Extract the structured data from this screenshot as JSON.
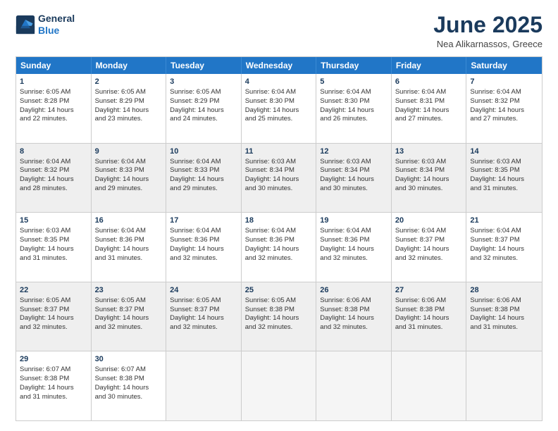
{
  "header": {
    "logo_line1": "General",
    "logo_line2": "Blue",
    "month": "June 2025",
    "location": "Nea Alikarnassos, Greece"
  },
  "weekdays": [
    "Sunday",
    "Monday",
    "Tuesday",
    "Wednesday",
    "Thursday",
    "Friday",
    "Saturday"
  ],
  "rows": [
    [
      {
        "day": "1",
        "lines": [
          "Sunrise: 6:05 AM",
          "Sunset: 8:28 PM",
          "Daylight: 14 hours",
          "and 22 minutes."
        ],
        "shade": false
      },
      {
        "day": "2",
        "lines": [
          "Sunrise: 6:05 AM",
          "Sunset: 8:29 PM",
          "Daylight: 14 hours",
          "and 23 minutes."
        ],
        "shade": false
      },
      {
        "day": "3",
        "lines": [
          "Sunrise: 6:05 AM",
          "Sunset: 8:29 PM",
          "Daylight: 14 hours",
          "and 24 minutes."
        ],
        "shade": false
      },
      {
        "day": "4",
        "lines": [
          "Sunrise: 6:04 AM",
          "Sunset: 8:30 PM",
          "Daylight: 14 hours",
          "and 25 minutes."
        ],
        "shade": false
      },
      {
        "day": "5",
        "lines": [
          "Sunrise: 6:04 AM",
          "Sunset: 8:30 PM",
          "Daylight: 14 hours",
          "and 26 minutes."
        ],
        "shade": false
      },
      {
        "day": "6",
        "lines": [
          "Sunrise: 6:04 AM",
          "Sunset: 8:31 PM",
          "Daylight: 14 hours",
          "and 27 minutes."
        ],
        "shade": false
      },
      {
        "day": "7",
        "lines": [
          "Sunrise: 6:04 AM",
          "Sunset: 8:32 PM",
          "Daylight: 14 hours",
          "and 27 minutes."
        ],
        "shade": false
      }
    ],
    [
      {
        "day": "8",
        "lines": [
          "Sunrise: 6:04 AM",
          "Sunset: 8:32 PM",
          "Daylight: 14 hours",
          "and 28 minutes."
        ],
        "shade": true
      },
      {
        "day": "9",
        "lines": [
          "Sunrise: 6:04 AM",
          "Sunset: 8:33 PM",
          "Daylight: 14 hours",
          "and 29 minutes."
        ],
        "shade": true
      },
      {
        "day": "10",
        "lines": [
          "Sunrise: 6:04 AM",
          "Sunset: 8:33 PM",
          "Daylight: 14 hours",
          "and 29 minutes."
        ],
        "shade": true
      },
      {
        "day": "11",
        "lines": [
          "Sunrise: 6:03 AM",
          "Sunset: 8:34 PM",
          "Daylight: 14 hours",
          "and 30 minutes."
        ],
        "shade": true
      },
      {
        "day": "12",
        "lines": [
          "Sunrise: 6:03 AM",
          "Sunset: 8:34 PM",
          "Daylight: 14 hours",
          "and 30 minutes."
        ],
        "shade": true
      },
      {
        "day": "13",
        "lines": [
          "Sunrise: 6:03 AM",
          "Sunset: 8:34 PM",
          "Daylight: 14 hours",
          "and 30 minutes."
        ],
        "shade": true
      },
      {
        "day": "14",
        "lines": [
          "Sunrise: 6:03 AM",
          "Sunset: 8:35 PM",
          "Daylight: 14 hours",
          "and 31 minutes."
        ],
        "shade": true
      }
    ],
    [
      {
        "day": "15",
        "lines": [
          "Sunrise: 6:03 AM",
          "Sunset: 8:35 PM",
          "Daylight: 14 hours",
          "and 31 minutes."
        ],
        "shade": false
      },
      {
        "day": "16",
        "lines": [
          "Sunrise: 6:04 AM",
          "Sunset: 8:36 PM",
          "Daylight: 14 hours",
          "and 31 minutes."
        ],
        "shade": false
      },
      {
        "day": "17",
        "lines": [
          "Sunrise: 6:04 AM",
          "Sunset: 8:36 PM",
          "Daylight: 14 hours",
          "and 32 minutes."
        ],
        "shade": false
      },
      {
        "day": "18",
        "lines": [
          "Sunrise: 6:04 AM",
          "Sunset: 8:36 PM",
          "Daylight: 14 hours",
          "and 32 minutes."
        ],
        "shade": false
      },
      {
        "day": "19",
        "lines": [
          "Sunrise: 6:04 AM",
          "Sunset: 8:36 PM",
          "Daylight: 14 hours",
          "and 32 minutes."
        ],
        "shade": false
      },
      {
        "day": "20",
        "lines": [
          "Sunrise: 6:04 AM",
          "Sunset: 8:37 PM",
          "Daylight: 14 hours",
          "and 32 minutes."
        ],
        "shade": false
      },
      {
        "day": "21",
        "lines": [
          "Sunrise: 6:04 AM",
          "Sunset: 8:37 PM",
          "Daylight: 14 hours",
          "and 32 minutes."
        ],
        "shade": false
      }
    ],
    [
      {
        "day": "22",
        "lines": [
          "Sunrise: 6:05 AM",
          "Sunset: 8:37 PM",
          "Daylight: 14 hours",
          "and 32 minutes."
        ],
        "shade": true
      },
      {
        "day": "23",
        "lines": [
          "Sunrise: 6:05 AM",
          "Sunset: 8:37 PM",
          "Daylight: 14 hours",
          "and 32 minutes."
        ],
        "shade": true
      },
      {
        "day": "24",
        "lines": [
          "Sunrise: 6:05 AM",
          "Sunset: 8:37 PM",
          "Daylight: 14 hours",
          "and 32 minutes."
        ],
        "shade": true
      },
      {
        "day": "25",
        "lines": [
          "Sunrise: 6:05 AM",
          "Sunset: 8:38 PM",
          "Daylight: 14 hours",
          "and 32 minutes."
        ],
        "shade": true
      },
      {
        "day": "26",
        "lines": [
          "Sunrise: 6:06 AM",
          "Sunset: 8:38 PM",
          "Daylight: 14 hours",
          "and 32 minutes."
        ],
        "shade": true
      },
      {
        "day": "27",
        "lines": [
          "Sunrise: 6:06 AM",
          "Sunset: 8:38 PM",
          "Daylight: 14 hours",
          "and 31 minutes."
        ],
        "shade": true
      },
      {
        "day": "28",
        "lines": [
          "Sunrise: 6:06 AM",
          "Sunset: 8:38 PM",
          "Daylight: 14 hours",
          "and 31 minutes."
        ],
        "shade": true
      }
    ],
    [
      {
        "day": "29",
        "lines": [
          "Sunrise: 6:07 AM",
          "Sunset: 8:38 PM",
          "Daylight: 14 hours",
          "and 31 minutes."
        ],
        "shade": false
      },
      {
        "day": "30",
        "lines": [
          "Sunrise: 6:07 AM",
          "Sunset: 8:38 PM",
          "Daylight: 14 hours",
          "and 30 minutes."
        ],
        "shade": false
      },
      {
        "day": "",
        "lines": [],
        "shade": false,
        "empty": true
      },
      {
        "day": "",
        "lines": [],
        "shade": false,
        "empty": true
      },
      {
        "day": "",
        "lines": [],
        "shade": false,
        "empty": true
      },
      {
        "day": "",
        "lines": [],
        "shade": false,
        "empty": true
      },
      {
        "day": "",
        "lines": [],
        "shade": false,
        "empty": true
      }
    ]
  ]
}
